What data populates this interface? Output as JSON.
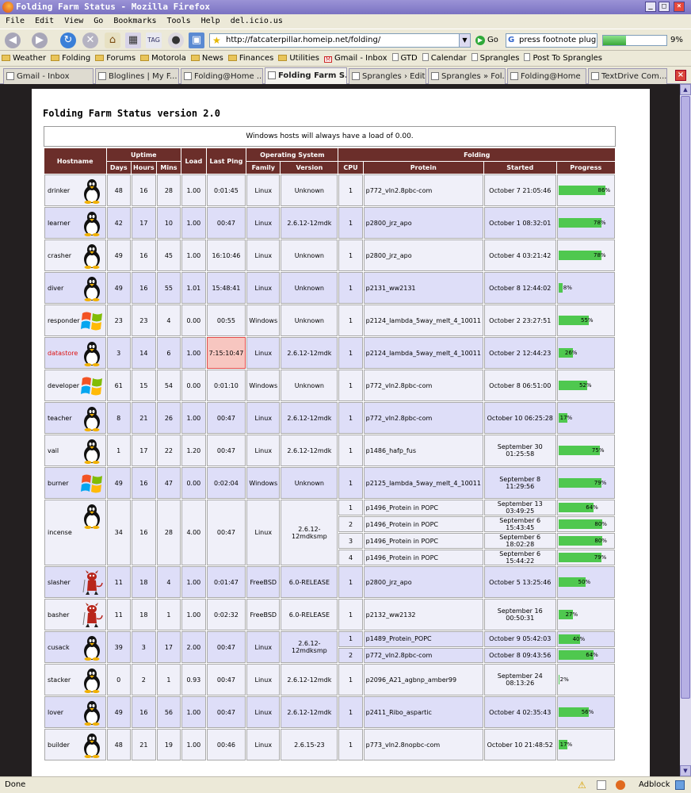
{
  "window": {
    "title": "Folding Farm Status - Mozilla Firefox"
  },
  "menu": [
    "File",
    "Edit",
    "View",
    "Go",
    "Bookmarks",
    "Tools",
    "Help",
    "del.icio.us"
  ],
  "toolbar": {
    "url": "http://fatcaterpillar.homeip.net/folding/",
    "go_label": "Go",
    "search_value": "press footnote plugin",
    "download_percent": 9,
    "download_label": "9%"
  },
  "bookmarks": [
    {
      "label": "Weather",
      "type": "folder"
    },
    {
      "label": "Folding",
      "type": "folder"
    },
    {
      "label": "Forums",
      "type": "folder"
    },
    {
      "label": "Motorola",
      "type": "folder"
    },
    {
      "label": "News",
      "type": "folder"
    },
    {
      "label": "Finances",
      "type": "folder"
    },
    {
      "label": "Utilities",
      "type": "folder"
    },
    {
      "label": "Gmail - Inbox",
      "type": "gmail"
    },
    {
      "label": "GTD",
      "type": "page"
    },
    {
      "label": "Calendar",
      "type": "page"
    },
    {
      "label": "Sprangles",
      "type": "page"
    },
    {
      "label": "Post To Sprangles",
      "type": "page"
    }
  ],
  "tabs": [
    {
      "label": "Gmail - Inbox",
      "active": false
    },
    {
      "label": "Bloglines | My F...",
      "active": false
    },
    {
      "label": "Folding@Home ...",
      "active": false
    },
    {
      "label": "Folding Farm S...",
      "active": true
    },
    {
      "label": "Sprangles › Edit...",
      "active": false
    },
    {
      "label": "Sprangles » Fol...",
      "active": false
    },
    {
      "label": "Folding@Home",
      "active": false
    },
    {
      "label": "TextDrive Com...",
      "active": false
    }
  ],
  "page": {
    "title": "Folding Farm Status version 2.0",
    "notice": "Windows hosts will always have a load of 0.00.",
    "headers": {
      "hostname": "Hostname",
      "uptime": "Uptime",
      "days": "Days",
      "hours": "Hours",
      "mins": "Mins",
      "load": "Load",
      "last_ping": "Last Ping",
      "os": "Operating System",
      "family": "Family",
      "version": "Version",
      "folding": "Folding",
      "cpu": "CPU",
      "protein": "Protein",
      "started": "Started",
      "progress": "Progress"
    },
    "hosts": [
      {
        "name": "drinker",
        "os_icon": "linux-penguin-icon",
        "days": "48",
        "hours": "16",
        "mins": "28",
        "load": "1.00",
        "ping": "0:01:45",
        "family": "Linux",
        "version": "Unknown",
        "alert": false,
        "jobs": [
          {
            "cpu": "1",
            "protein": "p772_vln2.8pbc-com",
            "started": "October 7 21:05:46",
            "progress": 86
          }
        ]
      },
      {
        "name": "learner",
        "os_icon": "linux-penguin-icon",
        "days": "42",
        "hours": "17",
        "mins": "10",
        "load": "1.00",
        "ping": "00:47",
        "family": "Linux",
        "version": "2.6.12-12mdk",
        "alert": false,
        "jobs": [
          {
            "cpu": "1",
            "protein": "p2800_jrz_apo",
            "started": "October 1 08:32:01",
            "progress": 78
          }
        ]
      },
      {
        "name": "crasher",
        "os_icon": "linux-penguin-icon",
        "days": "49",
        "hours": "16",
        "mins": "45",
        "load": "1.00",
        "ping": "16:10:46",
        "family": "Linux",
        "version": "Unknown",
        "alert": false,
        "jobs": [
          {
            "cpu": "1",
            "protein": "p2800_jrz_apo",
            "started": "October 4 03:21:42",
            "progress": 78
          }
        ]
      },
      {
        "name": "diver",
        "os_icon": "linux-penguin-icon",
        "days": "49",
        "hours": "16",
        "mins": "55",
        "load": "1.01",
        "ping": "15:48:41",
        "family": "Linux",
        "version": "Unknown",
        "alert": false,
        "jobs": [
          {
            "cpu": "1",
            "protein": "p2131_ww2131",
            "started": "October 8 12:44:02",
            "progress": 8
          }
        ]
      },
      {
        "name": "responder",
        "os_icon": "windows-flag-icon",
        "days": "23",
        "hours": "23",
        "mins": "4",
        "load": "0.00",
        "ping": "00:55",
        "family": "Windows",
        "version": "Unknown",
        "alert": false,
        "jobs": [
          {
            "cpu": "1",
            "protein": "p2124_lambda_5way_melt_4_10011",
            "started": "October 2 23:27:51",
            "progress": 55
          }
        ]
      },
      {
        "name": "datastore",
        "os_icon": "linux-penguin-icon",
        "days": "3",
        "hours": "14",
        "mins": "6",
        "load": "1.00",
        "ping": "7:15:10:47",
        "family": "Linux",
        "version": "2.6.12-12mdk",
        "alert": true,
        "jobs": [
          {
            "cpu": "1",
            "protein": "p2124_lambda_5way_melt_4_10011",
            "started": "October 2 12:44:23",
            "progress": 26
          }
        ]
      },
      {
        "name": "developer",
        "os_icon": "windows-flag-icon",
        "days": "61",
        "hours": "15",
        "mins": "54",
        "load": "0.00",
        "ping": "0:01:10",
        "family": "Windows",
        "version": "Unknown",
        "alert": false,
        "jobs": [
          {
            "cpu": "1",
            "protein": "p772_vln2.8pbc-com",
            "started": "October 8 06:51:00",
            "progress": 52
          }
        ]
      },
      {
        "name": "teacher",
        "os_icon": "linux-penguin-icon",
        "days": "8",
        "hours": "21",
        "mins": "26",
        "load": "1.00",
        "ping": "00:47",
        "family": "Linux",
        "version": "2.6.12-12mdk",
        "alert": false,
        "jobs": [
          {
            "cpu": "1",
            "protein": "p772_vln2.8pbc-com",
            "started": "October 10 06:25:28",
            "progress": 17
          }
        ]
      },
      {
        "name": "vail",
        "os_icon": "linux-penguin-icon",
        "days": "1",
        "hours": "17",
        "mins": "22",
        "load": "1.20",
        "ping": "00:47",
        "family": "Linux",
        "version": "2.6.12-12mdk",
        "alert": false,
        "jobs": [
          {
            "cpu": "1",
            "protein": "p1486_hafp_fus",
            "started": "September 30 01:25:58",
            "progress": 75
          }
        ]
      },
      {
        "name": "burner",
        "os_icon": "windows-flag-icon",
        "days": "49",
        "hours": "16",
        "mins": "47",
        "load": "0.00",
        "ping": "0:02:04",
        "family": "Windows",
        "version": "Unknown",
        "alert": false,
        "jobs": [
          {
            "cpu": "1",
            "protein": "p2125_lambda_5way_melt_4_10011",
            "started": "September 8 11:29:56",
            "progress": 79
          }
        ]
      },
      {
        "name": "incense",
        "os_icon": "linux-penguin-icon",
        "days": "34",
        "hours": "16",
        "mins": "28",
        "load": "4.00",
        "ping": "00:47",
        "family": "Linux",
        "version": "2.6.12-12mdksmp",
        "alert": false,
        "jobs": [
          {
            "cpu": "1",
            "protein": "p1496_Protein in POPC",
            "started": "September 13 03:49:25",
            "progress": 64
          },
          {
            "cpu": "2",
            "protein": "p1496_Protein in POPC",
            "started": "September 6 15:43:45",
            "progress": 80
          },
          {
            "cpu": "3",
            "protein": "p1496_Protein in POPC",
            "started": "September 6 18:02:28",
            "progress": 80
          },
          {
            "cpu": "4",
            "protein": "p1496_Protein in POPC",
            "started": "September 6 15:44:22",
            "progress": 79
          }
        ]
      },
      {
        "name": "slasher",
        "os_icon": "bsd-daemon-icon",
        "days": "11",
        "hours": "18",
        "mins": "4",
        "load": "1.00",
        "ping": "0:01:47",
        "family": "FreeBSD",
        "version": "6.0-RELEASE",
        "alert": false,
        "jobs": [
          {
            "cpu": "1",
            "protein": "p2800_jrz_apo",
            "started": "October 5 13:25:46",
            "progress": 50
          }
        ]
      },
      {
        "name": "basher",
        "os_icon": "bsd-daemon-icon",
        "days": "11",
        "hours": "18",
        "mins": "1",
        "load": "1.00",
        "ping": "0:02:32",
        "family": "FreeBSD",
        "version": "6.0-RELEASE",
        "alert": false,
        "jobs": [
          {
            "cpu": "1",
            "protein": "p2132_ww2132",
            "started": "September 16 00:50:31",
            "progress": 27
          }
        ]
      },
      {
        "name": "cusack",
        "os_icon": "linux-penguin-icon",
        "days": "39",
        "hours": "3",
        "mins": "17",
        "load": "2.00",
        "ping": "00:47",
        "family": "Linux",
        "version": "2.6.12-12mdksmp",
        "alert": false,
        "jobs": [
          {
            "cpu": "1",
            "protein": "p1489_Protein_POPC",
            "started": "October 9 05:42:03",
            "progress": 40
          },
          {
            "cpu": "2",
            "protein": "p772_vln2.8pbc-com",
            "started": "October 8 09:43:56",
            "progress": 64
          }
        ]
      },
      {
        "name": "stacker",
        "os_icon": "linux-penguin-icon",
        "days": "0",
        "hours": "2",
        "mins": "1",
        "load": "0.93",
        "ping": "00:47",
        "family": "Linux",
        "version": "2.6.12-12mdk",
        "alert": false,
        "jobs": [
          {
            "cpu": "1",
            "protein": "p2096_A21_agbnp_amber99",
            "started": "September 24 08:13:26",
            "progress": 2
          }
        ]
      },
      {
        "name": "lover",
        "os_icon": "linux-penguin-icon",
        "days": "49",
        "hours": "16",
        "mins": "56",
        "load": "1.00",
        "ping": "00:47",
        "family": "Linux",
        "version": "2.6.12-12mdk",
        "alert": false,
        "jobs": [
          {
            "cpu": "1",
            "protein": "p2411_Ribo_aspartic",
            "started": "October 4 02:35:43",
            "progress": 56
          }
        ]
      },
      {
        "name": "builder",
        "os_icon": "linux-penguin-icon",
        "days": "48",
        "hours": "21",
        "mins": "19",
        "load": "1.00",
        "ping": "00:46",
        "family": "Linux",
        "version": "2.6.15-23",
        "alert": false,
        "jobs": [
          {
            "cpu": "1",
            "protein": "p773_vln2.8nopbc-com",
            "started": "October 10 21:48:52",
            "progress": 17
          }
        ]
      }
    ]
  },
  "status": {
    "text": "Done",
    "adblock": "Adblock"
  },
  "colors": {
    "header_bg": "#6b2e2a",
    "row_odd": "#f0f0f9",
    "row_even": "#dedef8",
    "progress_fill": "#4fc84f",
    "alert_fill": "#f7c6c0",
    "alert_text": "#dd1111",
    "title_bar": "#7a72c2"
  }
}
